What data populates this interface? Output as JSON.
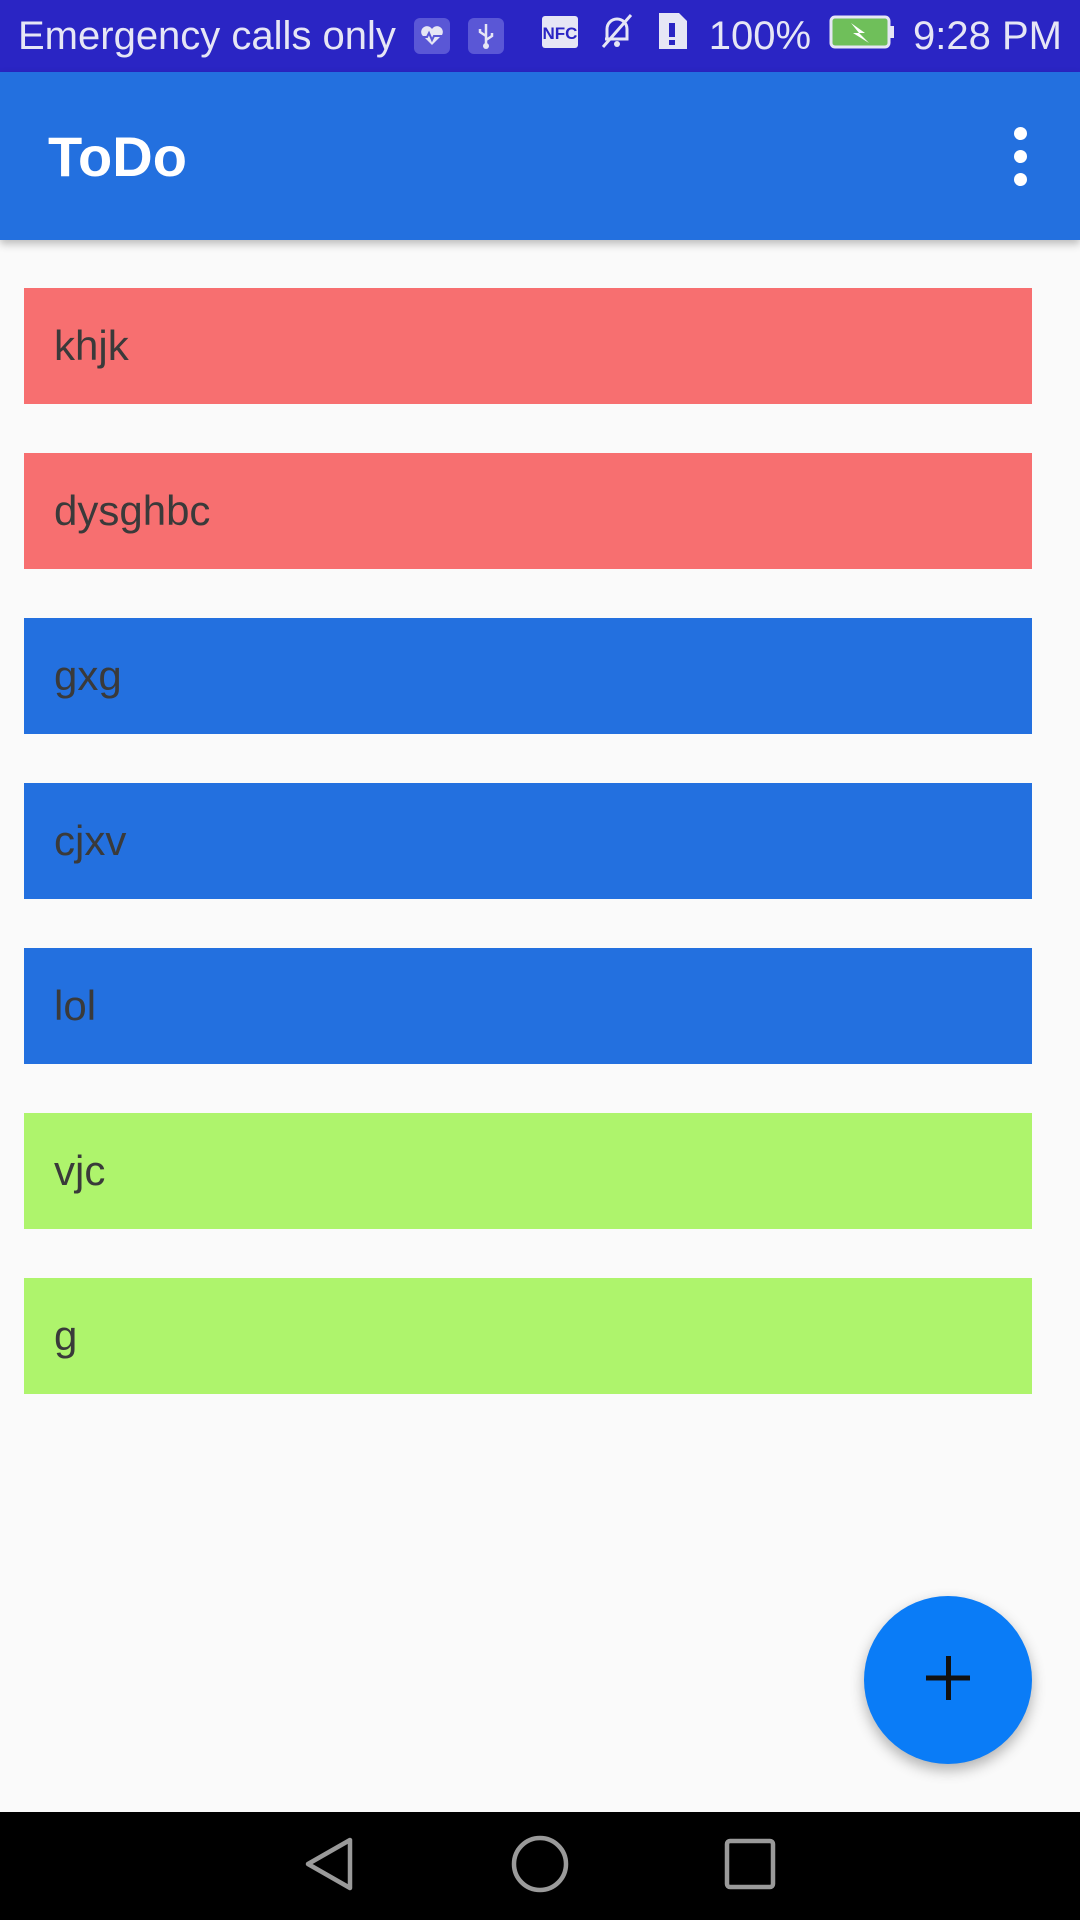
{
  "status_bar": {
    "carrier_text": "Emergency calls only",
    "battery_percent": "100%",
    "time": "9:28 PM",
    "left_icons": [
      "health-icon",
      "usb-icon"
    ],
    "right_icons": [
      "nfc-icon",
      "mute-icon",
      "sim-alert-icon",
      "battery-charging-icon"
    ]
  },
  "app_bar": {
    "title": "ToDo",
    "overflow_icon": "more-vert-icon"
  },
  "todos": [
    {
      "text": "khjk",
      "color": "#f76f70"
    },
    {
      "text": "dysghbc",
      "color": "#f76f70"
    },
    {
      "text": "gxg",
      "color": "#2370df"
    },
    {
      "text": "cjxv",
      "color": "#2370df"
    },
    {
      "text": "lol",
      "color": "#2370df"
    },
    {
      "text": "vjc",
      "color": "#aef46c"
    },
    {
      "text": "g",
      "color": "#aef46c"
    }
  ],
  "fab": {
    "icon": "add-icon",
    "color": "#0a7cf7"
  },
  "nav_bar": {
    "icons": [
      "back-icon",
      "home-icon",
      "recents-icon"
    ]
  },
  "colors": {
    "status_bar": "#2a25c4",
    "app_bar": "#2370df",
    "background": "#fafafa"
  }
}
